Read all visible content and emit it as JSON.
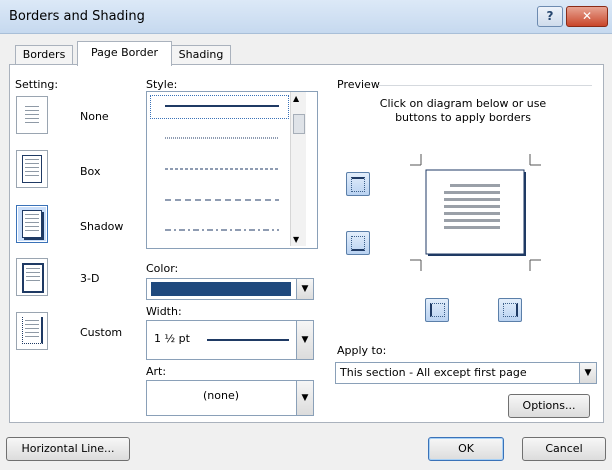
{
  "window": {
    "title": "Borders and Shading",
    "help_label": "?",
    "close_label": "✕"
  },
  "tabs": [
    {
      "label": "Borders",
      "active": false
    },
    {
      "label": "Page Border",
      "active": true
    },
    {
      "label": "Shading",
      "active": false
    }
  ],
  "setting": {
    "heading": "Setting:",
    "items": [
      {
        "label": "None",
        "icon": "none-border-icon"
      },
      {
        "label": "Box",
        "icon": "box-border-icon"
      },
      {
        "label": "Shadow",
        "icon": "shadow-border-icon",
        "selected": true
      },
      {
        "label": "3-D",
        "icon": "3d-border-icon"
      },
      {
        "label": "Custom",
        "icon": "custom-border-icon"
      }
    ]
  },
  "style": {
    "heading": "Style:"
  },
  "color": {
    "heading": "Color:",
    "value_color": "#1f497d"
  },
  "width": {
    "heading": "Width:",
    "value": "1 ½ pt"
  },
  "art": {
    "heading": "Art:",
    "value": "(none)"
  },
  "preview": {
    "heading": "Preview",
    "hint": "Click on diagram below or use buttons to apply borders"
  },
  "apply_to": {
    "heading": "Apply to:",
    "value": "This section - All except first page"
  },
  "buttons": {
    "options": "Options...",
    "horizontal_line": "Horizontal Line...",
    "ok": "OK",
    "cancel": "Cancel"
  }
}
